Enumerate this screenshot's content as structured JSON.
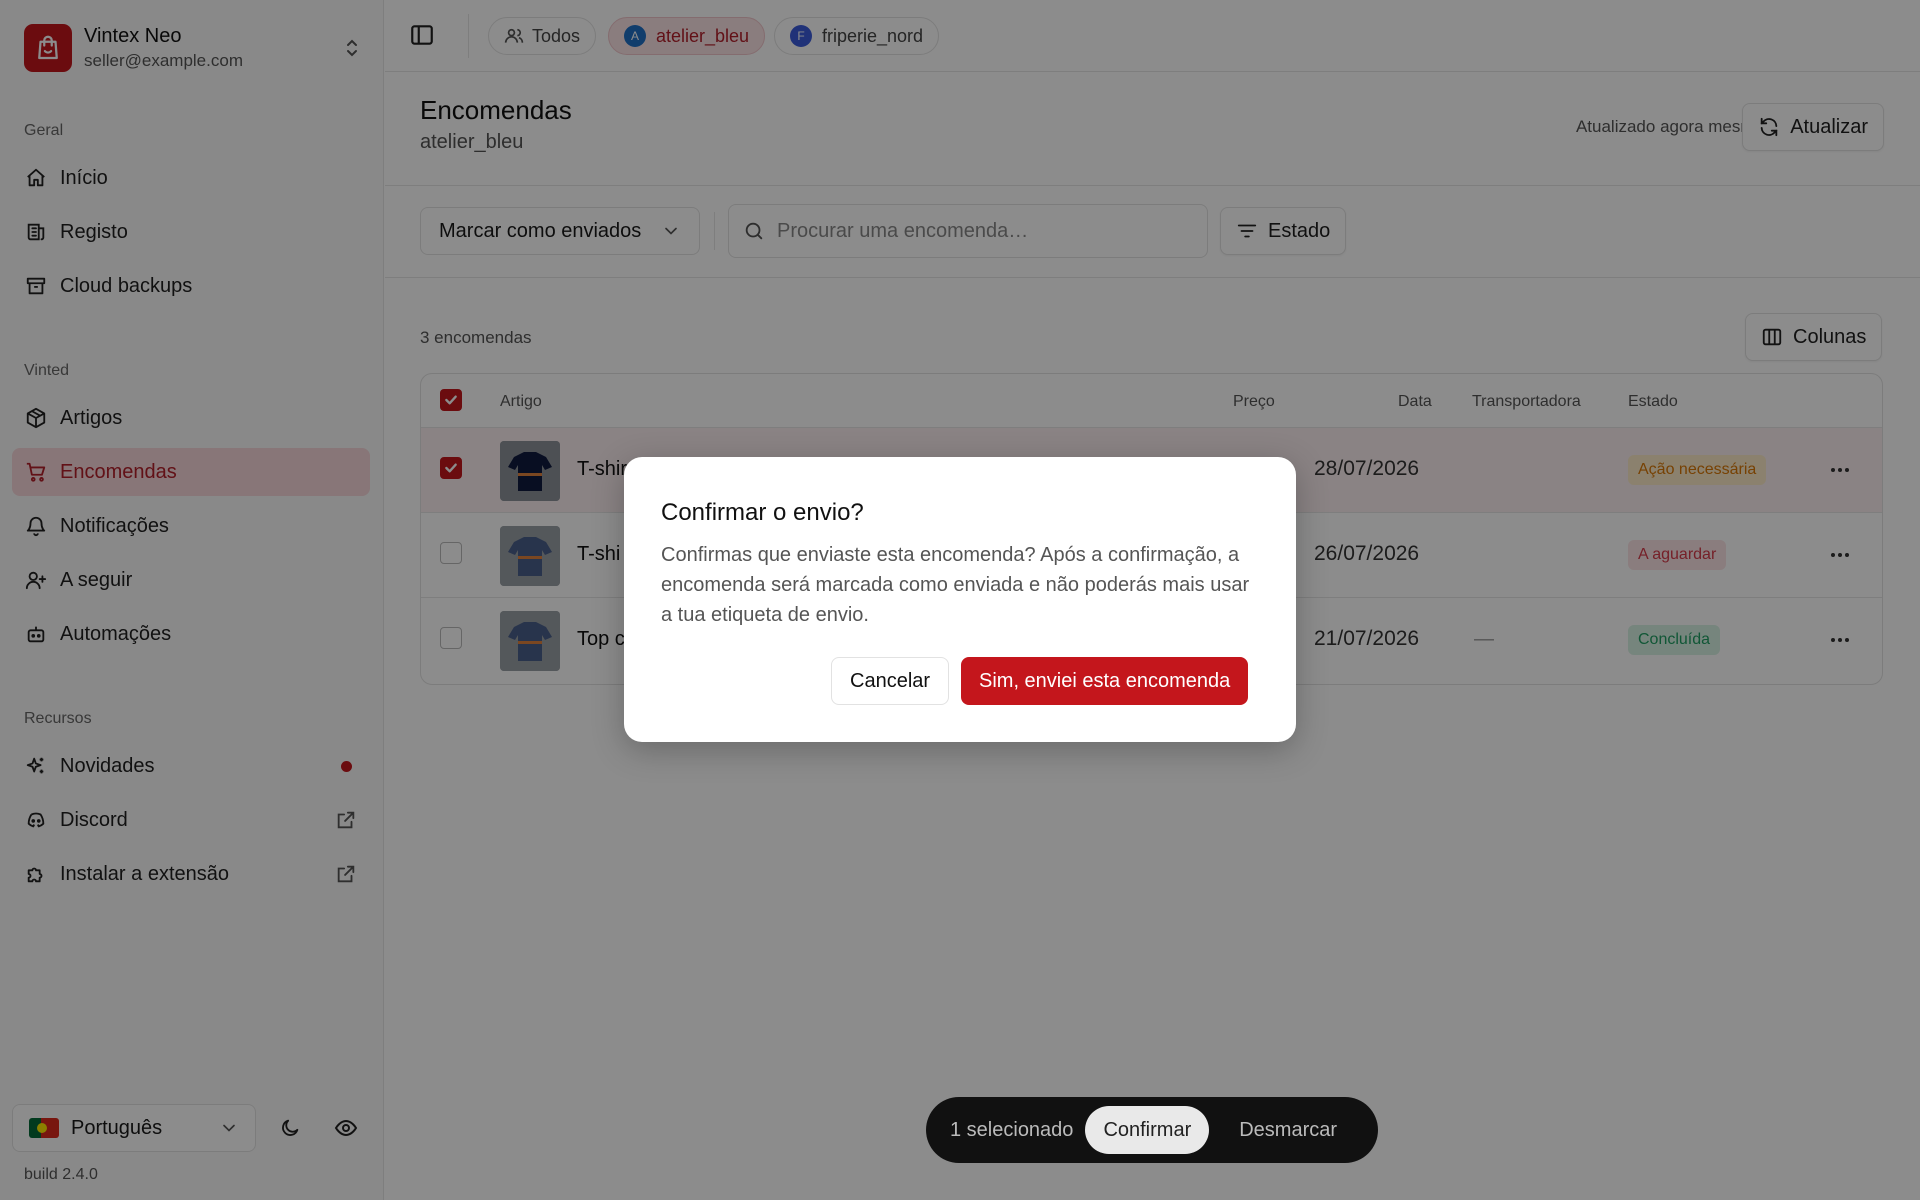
{
  "colors": {
    "accent": "#c4161c",
    "accent_soft": "#f7d7da",
    "warning": "#d97706",
    "warning_bg": "#fdecc8",
    "danger_text": "#d63b4a",
    "danger_bg": "#fbe3e5",
    "success_text": "#1f9e63",
    "success_bg": "#d7f2e3"
  },
  "account": {
    "name": "Vintex Neo",
    "email": "seller@example.com"
  },
  "sidebar": {
    "sections": [
      {
        "label": "Geral",
        "items": [
          {
            "label": "Início",
            "icon": "home-icon"
          },
          {
            "label": "Registo",
            "icon": "log-icon"
          },
          {
            "label": "Cloud backups",
            "icon": "archive-icon"
          }
        ]
      },
      {
        "label": "Vinted",
        "items": [
          {
            "label": "Artigos",
            "icon": "package-icon"
          },
          {
            "label": "Encomendas",
            "icon": "cart-icon",
            "active": true
          },
          {
            "label": "Notificações",
            "icon": "bell-icon"
          },
          {
            "label": "A seguir",
            "icon": "user-plus-icon"
          },
          {
            "label": "Automações",
            "icon": "bot-icon"
          }
        ]
      },
      {
        "label": "Recursos",
        "items": [
          {
            "label": "Novidades",
            "icon": "sparkles-icon",
            "badge": "red-dot"
          },
          {
            "label": "Discord",
            "icon": "discord-icon",
            "external": true
          },
          {
            "label": "Instalar a extensão",
            "icon": "puzzle-icon",
            "external": true
          }
        ]
      }
    ],
    "language": "Português",
    "build": "build 2.4.0"
  },
  "topbar": {
    "chips": [
      {
        "label": "Todos",
        "icon": "users-icon"
      },
      {
        "label": "atelier_bleu",
        "avatar": "A",
        "avatar_color": "#1f6fc5",
        "active": true
      },
      {
        "label": "friperie_nord",
        "avatar": "F",
        "avatar_color": "#3b5bdb"
      }
    ]
  },
  "page": {
    "title": "Encomendas",
    "subtitle": "atelier_bleu",
    "updated": "Atualizado agora mesmo",
    "refresh_label": "Atualizar"
  },
  "toolbar": {
    "bulk_action": "Marcar como enviados",
    "search_placeholder": "Procurar uma encomenda…",
    "filter_label": "Estado"
  },
  "orders": {
    "count": "3 encomendas",
    "columns_label": "Colunas",
    "headers": {
      "item": "Artigo",
      "price": "Preço",
      "date": "Data",
      "carrier": "Transportadora",
      "status": "Estado"
    },
    "rows": [
      {
        "name": "T-shir",
        "date": "28/07/2026",
        "carrier": "",
        "status": "Ação necessária",
        "status_kind": "warning",
        "selected": true
      },
      {
        "name": "T-shi",
        "date": "26/07/2026",
        "carrier": "",
        "status": "A aguardar",
        "status_kind": "danger",
        "selected": false
      },
      {
        "name": "Top c",
        "date": "21/07/2026",
        "carrier": "—",
        "status": "Concluída",
        "status_kind": "success",
        "selected": false
      }
    ]
  },
  "bulkbar": {
    "selected": "1 selecionado",
    "confirm": "Confirmar",
    "clear": "Desmarcar"
  },
  "modal": {
    "title": "Confirmar o envio?",
    "body": "Confirmas que enviaste esta encomenda? Após a confirmação, a encomenda será marcada como enviada e não poderás mais usar a tua etiqueta de envio.",
    "cancel": "Cancelar",
    "confirm": "Sim, enviei esta encomenda"
  }
}
